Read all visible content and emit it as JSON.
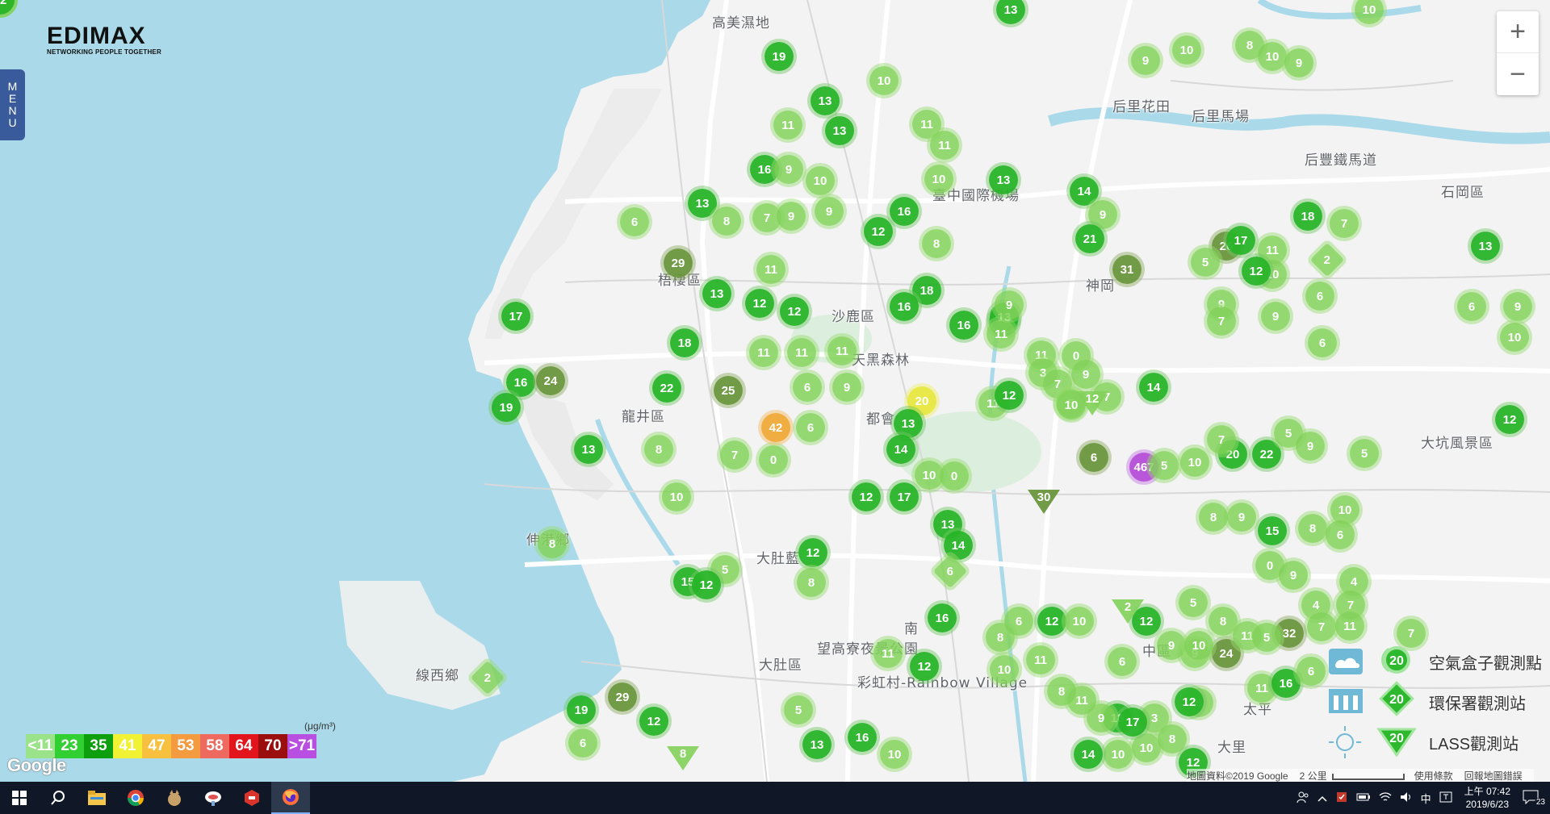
{
  "brand": {
    "name": "EDIMAX",
    "tagline": "NETWORKING PEOPLE TOGETHER"
  },
  "menu_label": [
    "M",
    "E",
    "N",
    "U"
  ],
  "zoom": {
    "in": "+",
    "out": "−"
  },
  "places": [
    {
      "text": "高美濕地"
    },
    {
      "text": "梧棲區"
    },
    {
      "text": "沙鹿區"
    },
    {
      "text": "龍井區"
    },
    {
      "text": "大肚區"
    },
    {
      "text": "后里花田"
    },
    {
      "text": "后里馬場"
    },
    {
      "text": "后豐鐵馬道"
    },
    {
      "text": "石岡區"
    },
    {
      "text": "臺中國際機場"
    },
    {
      "text": "大坑風景區"
    },
    {
      "text": "線西鄉"
    },
    {
      "text": "望高寮夜景公園"
    },
    {
      "text": "彩虹村-Rainbow Village"
    },
    {
      "text": "都會"
    },
    {
      "text": "南"
    },
    {
      "text": "中區"
    },
    {
      "text": "大肚藍"
    },
    {
      "text": "神岡"
    },
    {
      "text": "天黑森林"
    },
    {
      "text": "伸港鄉"
    },
    {
      "text": "大里"
    },
    {
      "text": "太平"
    }
  ],
  "markers": [
    {
      "v": "13",
      "k": "c2"
    },
    {
      "v": "10",
      "k": "c1"
    },
    {
      "v": "19",
      "k": "c2"
    },
    {
      "v": "10",
      "k": "c1"
    },
    {
      "v": "13",
      "k": "c2"
    },
    {
      "v": "11",
      "k": "c1"
    },
    {
      "v": "13",
      "k": "c2"
    },
    {
      "v": "11",
      "k": "c1"
    },
    {
      "v": "16",
      "k": "c2"
    },
    {
      "v": "9",
      "k": "c1"
    },
    {
      "v": "10",
      "k": "c1"
    },
    {
      "v": "13",
      "k": "c2"
    },
    {
      "v": "8",
      "k": "c1"
    },
    {
      "v": "7",
      "k": "c1"
    },
    {
      "v": "9",
      "k": "c1"
    },
    {
      "v": "9",
      "k": "c1"
    },
    {
      "v": "16",
      "k": "c2"
    },
    {
      "v": "12",
      "k": "c2"
    },
    {
      "v": "6",
      "k": "c1"
    },
    {
      "v": "29",
      "k": "c3"
    },
    {
      "v": "13",
      "k": "c2"
    },
    {
      "v": "11",
      "k": "c1"
    },
    {
      "v": "12",
      "k": "c2"
    },
    {
      "v": "12",
      "k": "c2"
    },
    {
      "v": "18",
      "k": "c2"
    },
    {
      "v": "17",
      "k": "c2"
    },
    {
      "v": "16",
      "k": "c2"
    },
    {
      "v": "24",
      "k": "c3"
    },
    {
      "v": "19",
      "k": "c2"
    },
    {
      "v": "18",
      "k": "c2"
    },
    {
      "v": "22",
      "k": "c2"
    },
    {
      "v": "25",
      "k": "c3"
    },
    {
      "v": "11",
      "k": "c1"
    },
    {
      "v": "11",
      "k": "c1"
    },
    {
      "v": "11",
      "k": "c1"
    },
    {
      "v": "6",
      "k": "c1"
    },
    {
      "v": "9",
      "k": "c1"
    },
    {
      "v": "13",
      "k": "c2"
    },
    {
      "v": "8",
      "k": "c1"
    },
    {
      "v": "7",
      "k": "c1"
    },
    {
      "v": "0",
      "k": "c1"
    },
    {
      "v": "42",
      "k": "c4"
    },
    {
      "v": "6",
      "k": "c1"
    },
    {
      "v": "10",
      "k": "c1"
    },
    {
      "v": "8",
      "k": "c1"
    },
    {
      "v": "13",
      "k": "c2"
    },
    {
      "v": "16",
      "k": "c2"
    },
    {
      "v": "18",
      "k": "c2"
    },
    {
      "v": "20",
      "k": "c6"
    },
    {
      "v": "13",
      "k": "c2"
    },
    {
      "v": "14",
      "k": "c2"
    },
    {
      "v": "12",
      "k": "c2"
    },
    {
      "v": "17",
      "k": "c2"
    },
    {
      "v": "10",
      "k": "c1"
    },
    {
      "v": "0",
      "k": "c1"
    },
    {
      "v": "13",
      "k": "c2"
    },
    {
      "v": "14",
      "k": "c2"
    },
    {
      "v": "12",
      "k": "c2"
    },
    {
      "v": "8",
      "k": "c1"
    },
    {
      "v": "5",
      "k": "c1"
    },
    {
      "v": "15",
      "k": "c2"
    },
    {
      "v": "12",
      "k": "c2"
    },
    {
      "v": "16",
      "k": "c2"
    },
    {
      "v": "11",
      "k": "c1"
    },
    {
      "v": "12",
      "k": "c2"
    },
    {
      "v": "5",
      "k": "c1"
    },
    {
      "v": "13",
      "k": "c2"
    },
    {
      "v": "16",
      "k": "c2"
    },
    {
      "v": "10",
      "k": "c1"
    },
    {
      "v": "19",
      "k": "c2"
    },
    {
      "v": "12",
      "k": "c2"
    },
    {
      "v": "29",
      "k": "c3"
    },
    {
      "v": "6",
      "k": "c1"
    },
    {
      "v": "8",
      "k": "c1"
    },
    {
      "v": "11",
      "k": "c1"
    },
    {
      "v": "14",
      "k": "c2"
    },
    {
      "v": "9",
      "k": "c1"
    },
    {
      "v": "21",
      "k": "c2"
    },
    {
      "v": "31",
      "k": "c3"
    },
    {
      "v": "13",
      "k": "c2"
    },
    {
      "v": "16",
      "k": "c2"
    },
    {
      "v": "11",
      "k": "c1"
    },
    {
      "v": "9",
      "k": "c1"
    },
    {
      "v": "11",
      "k": "c1"
    },
    {
      "v": "0",
      "k": "c1"
    },
    {
      "v": "3",
      "k": "c1"
    },
    {
      "v": "7",
      "k": "c1"
    },
    {
      "v": "9",
      "k": "c1"
    },
    {
      "v": "5",
      "k": "c1"
    },
    {
      "v": "10",
      "k": "c1"
    },
    {
      "v": "11",
      "k": "c1"
    },
    {
      "v": "12",
      "k": "c2"
    },
    {
      "v": "7",
      "k": "c1"
    },
    {
      "v": "14",
      "k": "c2"
    },
    {
      "v": "6",
      "k": "c3"
    },
    {
      "v": "467",
      "k": "c5"
    },
    {
      "v": "5",
      "k": "c1"
    },
    {
      "v": "10",
      "k": "c1"
    },
    {
      "v": "20",
      "k": "c2"
    },
    {
      "v": "22",
      "k": "c2"
    },
    {
      "v": "7",
      "k": "c1"
    },
    {
      "v": "8",
      "k": "c1"
    },
    {
      "v": "10",
      "k": "c1"
    },
    {
      "v": "9",
      "k": "c1"
    },
    {
      "v": "9",
      "k": "c1"
    },
    {
      "v": "10",
      "k": "c1"
    },
    {
      "v": "26",
      "k": "c3"
    },
    {
      "v": "17",
      "k": "c2"
    },
    {
      "v": "5",
      "k": "c1"
    },
    {
      "v": "11",
      "k": "c1"
    },
    {
      "v": "10",
      "k": "c1"
    },
    {
      "v": "9",
      "k": "c1"
    },
    {
      "v": "12",
      "k": "c2"
    },
    {
      "v": "18",
      "k": "c2"
    },
    {
      "v": "7",
      "k": "c1"
    },
    {
      "v": "6",
      "k": "c1"
    },
    {
      "v": "9",
      "k": "c1"
    },
    {
      "v": "7",
      "k": "c1"
    },
    {
      "v": "10",
      "k": "c1"
    },
    {
      "v": "6",
      "k": "c1"
    },
    {
      "v": "5",
      "k": "c1"
    },
    {
      "v": "9",
      "k": "c1"
    },
    {
      "v": "5",
      "k": "c1"
    },
    {
      "v": "15",
      "k": "c2"
    },
    {
      "v": "10",
      "k": "c1"
    },
    {
      "v": "8",
      "k": "c1"
    },
    {
      "v": "9",
      "k": "c1"
    },
    {
      "v": "8",
      "k": "c1"
    },
    {
      "v": "0",
      "k": "c1"
    },
    {
      "v": "6",
      "k": "c1"
    },
    {
      "v": "9",
      "k": "c1"
    },
    {
      "v": "4",
      "k": "c1"
    },
    {
      "v": "5",
      "k": "c1"
    },
    {
      "v": "9",
      "k": "c1"
    },
    {
      "v": "24",
      "k": "c3"
    },
    {
      "v": "4",
      "k": "c1"
    },
    {
      "v": "7",
      "k": "c1"
    },
    {
      "v": "7",
      "k": "c1"
    },
    {
      "v": "32",
      "k": "c3"
    },
    {
      "v": "11",
      "k": "c1"
    },
    {
      "v": "11",
      "k": "c1"
    },
    {
      "v": "16",
      "k": "c2"
    },
    {
      "v": "6",
      "k": "c1"
    },
    {
      "v": "3",
      "k": "c1"
    },
    {
      "v": "18",
      "k": "c2"
    },
    {
      "v": "10",
      "k": "c1"
    },
    {
      "v": "10",
      "k": "c1"
    },
    {
      "v": "8",
      "k": "c1"
    },
    {
      "v": "12",
      "k": "c2"
    },
    {
      "v": "12",
      "k": "c2"
    },
    {
      "v": "17",
      "k": "c2"
    },
    {
      "v": "9",
      "k": "c1"
    },
    {
      "v": "14",
      "k": "c2"
    },
    {
      "v": "11",
      "k": "c1"
    },
    {
      "v": "8",
      "k": "c1"
    },
    {
      "v": "11",
      "k": "c1"
    },
    {
      "v": "10",
      "k": "c1"
    },
    {
      "v": "8",
      "k": "c1"
    },
    {
      "v": "6",
      "k": "c1"
    },
    {
      "v": "12",
      "k": "c2"
    },
    {
      "v": "10",
      "k": "c1"
    },
    {
      "v": "6",
      "k": "c1"
    },
    {
      "v": "12",
      "k": "c2"
    },
    {
      "v": "9",
      "k": "c1"
    },
    {
      "v": "10",
      "k": "c1"
    },
    {
      "v": "8",
      "k": "c1"
    },
    {
      "v": "11",
      "k": "c1"
    },
    {
      "v": "5",
      "k": "c1"
    },
    {
      "v": "6",
      "k": "c1"
    },
    {
      "v": "7",
      "k": "c1"
    },
    {
      "v": "12",
      "k": "c2"
    },
    {
      "v": "13",
      "k": "c2"
    },
    {
      "v": "9",
      "k": "c1"
    },
    {
      "v": "6",
      "k": "c1"
    },
    {
      "v": "10",
      "k": "c1"
    },
    {
      "v": "11",
      "k": "c1"
    },
    {
      "v": "9",
      "k": "c1"
    },
    {
      "v": "8",
      "k": "c1"
    },
    {
      "v": "5",
      "k": "c1"
    },
    {
      "v": "5",
      "k": "c1"
    },
    {
      "v": "6",
      "k": "c1"
    },
    {
      "v": "11",
      "k": "c1"
    },
    {
      "v": "5",
      "k": "c1"
    },
    {
      "v": "9",
      "k": "c1"
    },
    {
      "v": "12",
      "k": "c2"
    }
  ],
  "special_markers": [
    {
      "v": "2",
      "shape": "diamond",
      "k": "c1"
    },
    {
      "v": "6",
      "shape": "diamond",
      "k": "c1"
    },
    {
      "v": "2",
      "shape": "diamond",
      "k": "c1"
    },
    {
      "v": "30",
      "shape": "tri",
      "k": "dark"
    },
    {
      "v": "8",
      "shape": "tri",
      "k": "c1"
    },
    {
      "v": "12",
      "shape": "tri",
      "k": "c1"
    },
    {
      "v": "2",
      "shape": "tri",
      "k": "c1"
    }
  ],
  "aqi_legend": {
    "unit": "(μg/m³)",
    "segments": [
      {
        "label": "<11",
        "color": "#9be38a"
      },
      {
        "label": "23",
        "color": "#31cf31"
      },
      {
        "label": "35",
        "color": "#0e9f0e"
      },
      {
        "label": "41",
        "color": "#f2f234"
      },
      {
        "label": "47",
        "color": "#f7c13f"
      },
      {
        "label": "53",
        "color": "#f49a3f"
      },
      {
        "label": "58",
        "color": "#ef6a5e"
      },
      {
        "label": "64",
        "color": "#e3151c"
      },
      {
        "label": "70",
        "color": "#9b0e0e"
      },
      {
        "label": ">71",
        "color": "#b84fe0"
      }
    ]
  },
  "station_legend": [
    {
      "label": "空氣盒子觀測點",
      "icon": "circle",
      "value": "20"
    },
    {
      "label": "環保署觀測站",
      "icon": "diamond",
      "value": "20"
    },
    {
      "label": "LASS觀測站",
      "icon": "triangle",
      "value": "20"
    }
  ],
  "google_logo": "Google",
  "attribution": {
    "data": "地圖資料©2019 Google",
    "scale": "2 公里",
    "terms": "使用條款",
    "report": "回報地圖錯誤"
  },
  "taskbar": {
    "clock_time": "上午 07:42",
    "clock_date": "2019/6/23",
    "ime": "中",
    "notifications": "23",
    "apps": [
      {
        "name": "windows-start-icon"
      },
      {
        "name": "search-icon"
      },
      {
        "name": "file-explorer-icon"
      },
      {
        "name": "chrome-icon"
      },
      {
        "name": "app-icon-1"
      },
      {
        "name": "app-icon-2"
      },
      {
        "name": "app-icon-3"
      },
      {
        "name": "firefox-icon"
      }
    ]
  },
  "colors": {
    "water": "#aadaea",
    "land": "#f5f5f5",
    "road": "#ffffff",
    "green_park": "#dceedd"
  }
}
